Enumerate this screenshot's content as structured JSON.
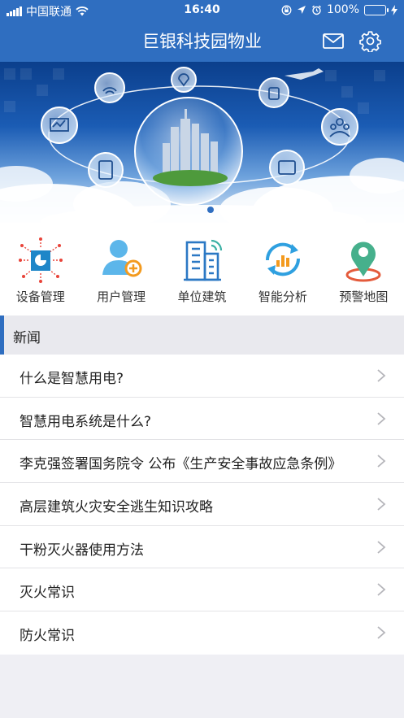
{
  "status_bar": {
    "carrier": "中国联通",
    "time": "16:40",
    "battery": "100%"
  },
  "header": {
    "title": "巨银科技园物业",
    "icons": [
      "mail-icon",
      "settings-gear-icon"
    ]
  },
  "banner": {
    "pagination_total": 1,
    "pagination_active": 1
  },
  "quick_menu": [
    {
      "label": "设备管理",
      "icon": "device-management-icon"
    },
    {
      "label": "用户管理",
      "icon": "user-management-icon"
    },
    {
      "label": "单位建筑",
      "icon": "building-icon"
    },
    {
      "label": "智能分析",
      "icon": "smart-analysis-icon"
    },
    {
      "label": "预警地图",
      "icon": "warning-map-pin-icon"
    }
  ],
  "news": {
    "section_title": "新闻",
    "items": [
      "什么是智慧用电?",
      "智慧用电系统是什么?",
      "李克强签署国务院令 公布《生产安全事故应急条例》",
      "高层建筑火灾安全逃生知识攻略",
      "干粉灭火器使用方法",
      "灭火常识",
      "防火常识"
    ]
  },
  "colors": {
    "brand_blue": "#2f6ec0",
    "accent_orange": "#f39a1e",
    "map_pin_green": "#46b08c",
    "map_ring_red": "#e45b3c"
  }
}
